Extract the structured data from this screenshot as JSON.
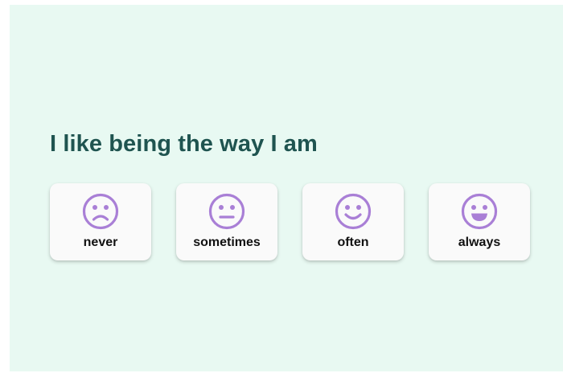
{
  "question": {
    "text": "I like being the way I am"
  },
  "options": [
    {
      "label": "never",
      "icon": "frowning-face-icon"
    },
    {
      "label": "sometimes",
      "icon": "neutral-face-icon"
    },
    {
      "label": "often",
      "icon": "smiling-face-icon"
    },
    {
      "label": "always",
      "icon": "grinning-face-icon"
    }
  ],
  "colors": {
    "background": "#e8f9f2",
    "heading": "#1f5450",
    "icon": "#a97fd6",
    "card": "#fafafa"
  }
}
